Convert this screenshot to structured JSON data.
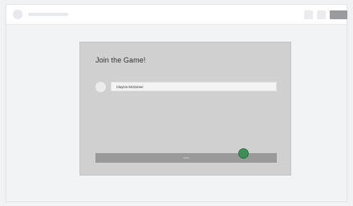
{
  "dialog": {
    "title": "Join the Game!",
    "name_input": {
      "value": "Clayton McGamer"
    },
    "join_button_label": "Join"
  },
  "colors": {
    "card_bg": "#d0d0d0",
    "button_bg": "#9a9a9a",
    "cursor_dot": "#3d8f58"
  }
}
